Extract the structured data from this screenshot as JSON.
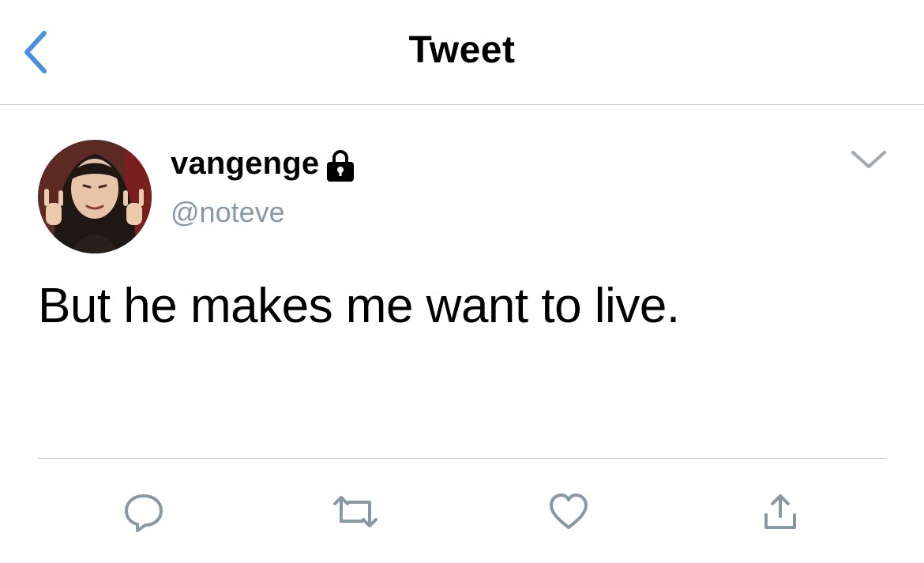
{
  "nav": {
    "title": "Tweet",
    "back_icon": "chevron-left-icon",
    "accent_color": "#4a90e2"
  },
  "tweet": {
    "display_name": "vangenge",
    "handle": "@noteve",
    "protected": true,
    "text": "But he makes me want to live.",
    "menu_icon": "chevron-down-icon"
  },
  "actions": [
    {
      "name": "reply",
      "icon": "comment-icon"
    },
    {
      "name": "retweet",
      "icon": "retweet-icon"
    },
    {
      "name": "like",
      "icon": "heart-icon"
    },
    {
      "name": "share",
      "icon": "share-icon"
    }
  ],
  "colors": {
    "text": "#000000",
    "secondary_text": "#8899a6",
    "icon_gray": "#8899a6",
    "divider": "#c8c8cc"
  }
}
